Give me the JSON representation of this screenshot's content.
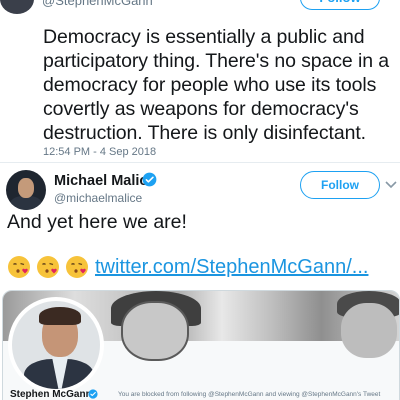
{
  "top_tweet": {
    "handle": "@StephenMcGann",
    "follow_label": "Follow",
    "text": "Democracy is essentially a public and participatory thing. There's no space in a democracy for people who use its tools covertly as weapons for democracy's destruction. There is only disinfectant.",
    "timestamp": "12:54 PM - 4 Sep 2018"
  },
  "reply_tweet": {
    "name": "Michael Malice",
    "handle": "@michaelmalice",
    "follow_label": "Follow",
    "text": "And yet here we are!",
    "emojis": [
      "kissing-face-heart-emoji",
      "kissing-face-heart-emoji",
      "kissing-face-heart-emoji"
    ],
    "link_text": "twitter.com/StephenMcGann/..."
  },
  "card": {
    "profile_name": "Stephen McGann",
    "blocked_message": "You are blocked from following @StephenMcGann and viewing @StephenMcGann's Tweet"
  },
  "colors": {
    "accent": "#1da1f2",
    "link": "#1b95e0",
    "text": "#14171a",
    "muted": "#657786"
  }
}
